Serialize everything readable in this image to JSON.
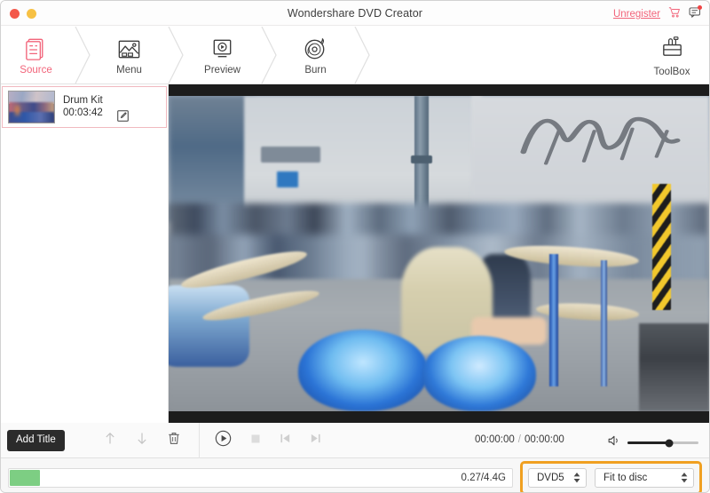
{
  "window": {
    "title": "Wondershare DVD Creator",
    "buttons": {
      "close": "close",
      "minimize": "minimize"
    }
  },
  "titlebar": {
    "unregister_label": "Unregister",
    "cart_icon": "shopping-cart-icon",
    "message_icon": "message-icon",
    "message_badge": true
  },
  "ribbon": {
    "steps": [
      {
        "label": "Source",
        "icon": "document-pages-icon",
        "active": true
      },
      {
        "label": "Menu",
        "icon": "image-picture-icon",
        "active": false
      },
      {
        "label": "Preview",
        "icon": "monitor-play-icon",
        "active": false
      },
      {
        "label": "Burn",
        "icon": "disc-burn-icon",
        "active": false
      }
    ],
    "toolbox": {
      "label": "ToolBox",
      "icon": "toolbox-icon"
    }
  },
  "sidebar": {
    "titles": [
      {
        "name": "Drum Kit",
        "duration": "00:03:42",
        "edit_icon": "edit-square-icon",
        "selected": true
      }
    ]
  },
  "transport": {
    "add_title_label": "Add Title",
    "list_tools": [
      {
        "name": "move-up",
        "icon": "arrow-up-icon"
      },
      {
        "name": "move-down",
        "icon": "arrow-down-icon"
      },
      {
        "name": "delete",
        "icon": "trash-icon"
      }
    ],
    "play_tools": [
      {
        "name": "play",
        "icon": "play-icon",
        "enabled": true
      },
      {
        "name": "stop",
        "icon": "stop-icon",
        "enabled": false
      },
      {
        "name": "previous",
        "icon": "previous-icon",
        "enabled": false
      },
      {
        "name": "next",
        "icon": "next-icon",
        "enabled": false
      }
    ],
    "current_time": "00:00:00",
    "time_separator": "/",
    "total_time": "00:00:00",
    "volume_icon": "speaker-volume-icon",
    "volume_percent": 59
  },
  "bottom": {
    "capacity_text": "0.27/4.4G",
    "capacity_percent": 6,
    "capacity_fill_color": "#7dce83",
    "highlight_color": "#f0a021",
    "disc_type": {
      "value": "DVD5",
      "icon": "stepper-arrows-icon"
    },
    "fit_mode": {
      "value": "Fit to disc",
      "icon": "stepper-arrows-icon"
    }
  },
  "preview": {
    "description": "Drum kit street performance video frame",
    "letterboxed": true
  }
}
